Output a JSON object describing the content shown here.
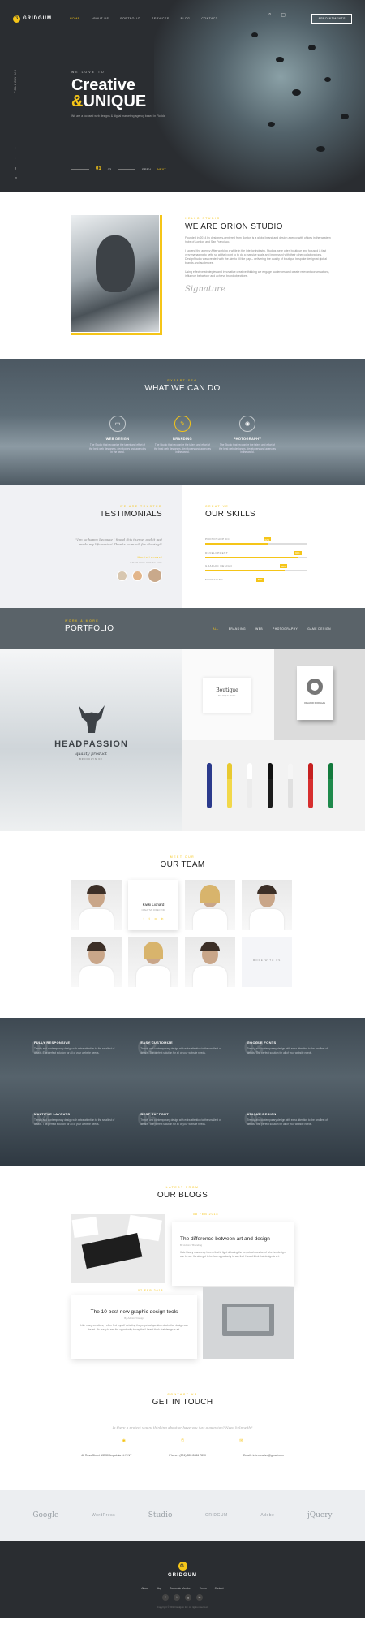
{
  "nav": {
    "logo_letter": "G",
    "brand": "GRIDGUM",
    "items": [
      "HOME",
      "ABOUT US",
      "PORTFOLIO",
      "SERVICES",
      "BLOG",
      "CONTACT"
    ],
    "active_index": 0,
    "search_glyph": "⌕",
    "cart_glyph": "▢",
    "appointment": "APPOINTMENTS"
  },
  "hero": {
    "pre": "WE LOVE TO",
    "title_line1": "Creative",
    "title_amp": "&",
    "title_line2": "UNIQUE",
    "desc": "We are a focused web designs & digital marketing agency based in Florida",
    "follow": "FOLLOW US",
    "socials": [
      "f",
      "t",
      "g",
      "in"
    ],
    "slide_current": "01",
    "slide_total": "03",
    "prev": "PREV",
    "next": "NEXT"
  },
  "about": {
    "pre": "HELLO STUDIO",
    "title": "WE ARE ORION STUDIO",
    "p1": "Founded in 2014 by designers-centered from Boston is a global brand and design agency with offices in the western hubs of London and San Francisco.",
    "p2": "I spoend the agency After working a while in the interior industry. Studios were often boutique and focused & fast very managing to write so at that point to to do a massive scale and impressed with their other collaborations. DesignStudio was created with the aim to fill the gap – delivering the quality of boutique bespoke design at global brands and audiences.",
    "p3": "Using effective strategies and innovative creative thinking we engage audiences and create relevant conversations, influence behaviour and achieve brand objectives.",
    "signature": "Signature"
  },
  "services": {
    "pre": "EXPERT SEO",
    "title": "WHAT WE CAN DO",
    "items": [
      {
        "icon": "monitor-icon",
        "glyph": "▭",
        "title": "WEB DESIGN",
        "desc": "The Studio that recognize the talent and effort of the best web designers, developers and agencies in the world."
      },
      {
        "icon": "branding-icon",
        "glyph": "✎",
        "title": "BRANDING",
        "desc": "The Studio that recognize the talent and effort of the best web designers, developers and agencies in the world."
      },
      {
        "icon": "camera-icon",
        "glyph": "◉",
        "title": "PHOTOGRAPHY",
        "desc": "The Studio that recognize the talent and effort of the best web designers, developers and agencies in the world."
      }
    ]
  },
  "testimonials": {
    "pre": "WE ARE TRUSTED",
    "title": "TESTIMONIALS",
    "quote": "\"I'm so happy because i found this theme, and it just made my life easier! Thanks so much for sharing!\"",
    "name": "Martin Leonard",
    "position": "CREATIVE DIRECTOR"
  },
  "skills": {
    "pre": "CREATIVE",
    "title": "OUR SKILLS",
    "items": [
      {
        "label": "PHOTOSHOP CC",
        "value": 62
      },
      {
        "label": "DEVELOPMENT",
        "value": 92
      },
      {
        "label": "GRAPHIC DESIGN",
        "value": 78
      },
      {
        "label": "MARKETING",
        "value": 55
      }
    ]
  },
  "portfolio": {
    "pre": "WORK & MORE",
    "title": "PORTFOLIO",
    "tabs": [
      "ALL",
      "BRANDING",
      "WEB",
      "PHOTOGRAPHY",
      "GAME DESIGN"
    ],
    "active_tab": 0,
    "brand": "HEADPASSION",
    "tagline": "quality product",
    "sub": "BROOKLYN NY",
    "card_title": "Boutique",
    "card_sub": "BOUTIQUE HOTEL",
    "book_title": "ORLANDO MOREGAN"
  },
  "team": {
    "pre": "MEET OUR",
    "title": "OUR TEAM",
    "featured_name": "Kiwki Lionard",
    "featured_role": "CREATIVE DIRECTOR",
    "featured_socials": [
      "f",
      "t",
      "g",
      "in"
    ],
    "more": "MORE WITH US"
  },
  "features": [
    {
      "num": "01",
      "title": "FULLY RESPONSIVE",
      "desc": "Trendy and contemporary design with extra attention to the smallest of details. The perfect solution for all of your website needs."
    },
    {
      "num": "02",
      "title": "EASY CUSTOMIZE",
      "desc": "Trendy and contemporary design with extra attention to the smallest of details. The perfect solution for all of your website needs."
    },
    {
      "num": "03",
      "title": "GOOGLE FONTS",
      "desc": "Trendy and contemporary design with extra attention to the smallest of details. The perfect solution for all of your website needs."
    },
    {
      "num": "04",
      "title": "MULTIPLE LAYOUTS",
      "desc": "Trendy and contemporary design with extra attention to the smallest of details. The perfect solution for all of your website needs."
    },
    {
      "num": "05",
      "title": "BEST SUPPORT",
      "desc": "Trendy and contemporary design with extra attention to the smallest of details. The perfect solution for all of your website needs."
    },
    {
      "num": "06",
      "title": "UNIQUE DESIGN",
      "desc": "Trendy and contemporary design with extra attention to the smallest of details. The perfect solution for all of your website needs."
    }
  ],
  "blogs": {
    "pre": "LATEST FROM",
    "title": "OUR BLOGS",
    "post1": {
      "date": "08 FEB 2018",
      "title": "The difference between art and design",
      "by": "By Admin / Branding",
      "excerpt": "Kate kissey marchesy. Lorem that le light debating the perpetual question of whether design can be art. It's also got to be how opportunity to say that I heard think that design is art."
    },
    "post2": {
      "date": "07 FEB 2018",
      "title": "The 10 best new graphic design tools",
      "by": "By Admin / Design",
      "excerpt": "Like many creatives, I often find myself debating the perpetual question of whether design can be art. It's crazy to see the opportunity to say that I heard think that design is art."
    }
  },
  "contact": {
    "pre": "CONTACT US",
    "title": "GET IN TOUCH",
    "question": "Is there a project you're thinking about or have you just a question? Need help with?",
    "address": "46 Ross Street 13530 Angulmia N.Y, NY",
    "phone": "Phone : (801) 555 8086 7890",
    "email": "Email : info.creative@gmail.com"
  },
  "partners": [
    "Google",
    "WordPress",
    "Studio",
    "GRIDGUM",
    "Adobe",
    "jQuery"
  ],
  "footer": {
    "brand": "GRIDGUM",
    "menu": [
      "About",
      "Blog",
      "Corporate Member",
      "Terms",
      "Contact"
    ],
    "socials": [
      "f",
      "t",
      "g",
      "in"
    ],
    "copyright": "Copyright © 2018 Gridgum Inc. All rights reserved."
  }
}
